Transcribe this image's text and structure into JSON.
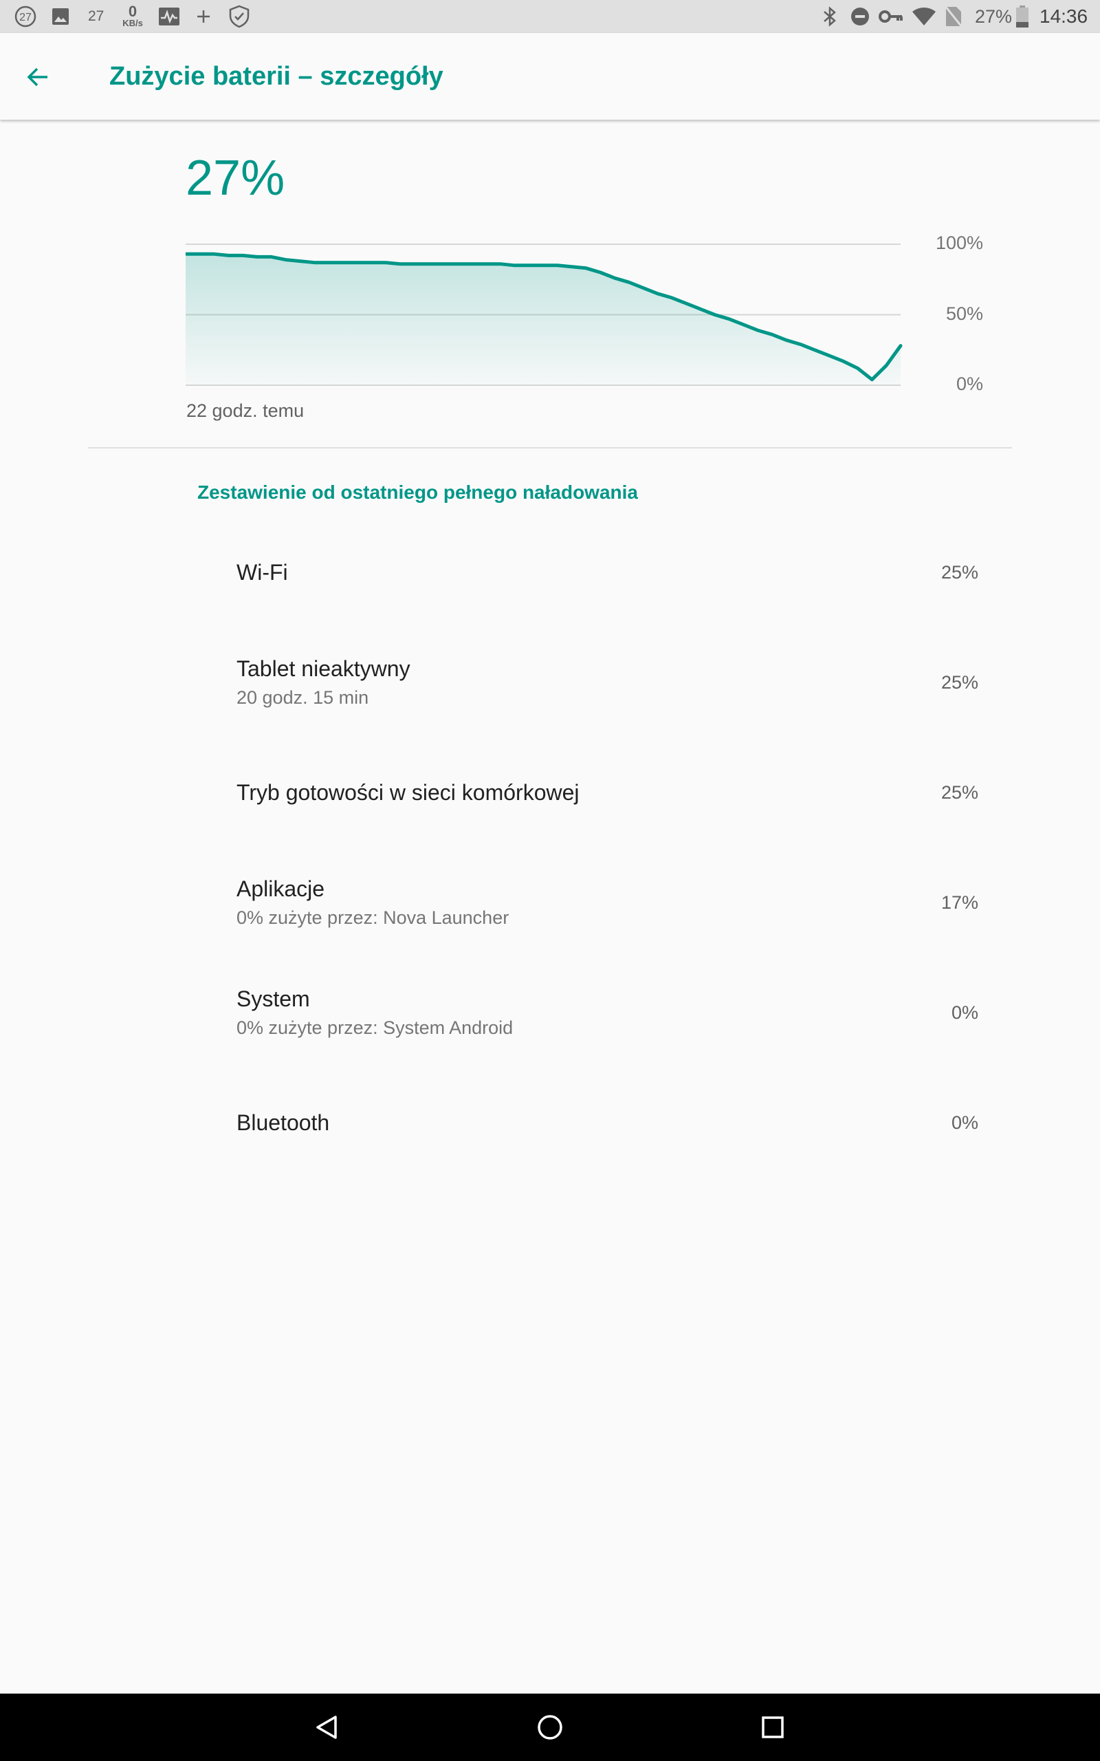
{
  "status_bar": {
    "notif_badge": "27",
    "notif_number": "27",
    "net_speed_value": "0",
    "net_speed_unit": "KB/s",
    "battery_percent": "27%",
    "time": "14:36",
    "icons": [
      "circle-27-icon",
      "image-icon",
      "activity-icon",
      "plus-icon",
      "shield-check-icon",
      "bluetooth-icon",
      "do-not-disturb-icon",
      "vpn-key-icon",
      "wifi-icon",
      "no-sim-icon",
      "battery-icon"
    ]
  },
  "app_bar": {
    "title": "Zużycie baterii – szczegóły",
    "back_icon": "arrow-back-icon"
  },
  "battery": {
    "level": "27%",
    "chart_caption": "22 godz. temu"
  },
  "chart_data": {
    "type": "area",
    "ylabel": "",
    "xlabel": "",
    "ylim": [
      0,
      100
    ],
    "y_ticks": [
      "100%",
      "50%",
      "0%"
    ],
    "x_start_label": "22 godz. temu",
    "x": [
      0,
      1,
      2,
      3,
      4,
      5,
      6,
      7,
      8,
      9,
      10,
      11,
      12,
      13,
      14,
      15,
      16,
      17,
      18,
      19,
      20,
      21,
      22,
      23,
      24,
      25,
      26,
      27,
      28,
      29,
      30,
      31,
      32,
      33,
      34,
      35,
      36,
      37,
      38,
      39,
      40,
      41,
      42,
      43,
      44,
      45,
      46,
      47,
      48,
      49,
      50
    ],
    "values": [
      93,
      93,
      93,
      92,
      92,
      91,
      91,
      89,
      88,
      87,
      87,
      87,
      87,
      87,
      87,
      86,
      86,
      86,
      86,
      86,
      86,
      86,
      86,
      85,
      85,
      85,
      85,
      84,
      83,
      80,
      76,
      73,
      69,
      65,
      62,
      58,
      54,
      50,
      47,
      43,
      39,
      36,
      32,
      29,
      25,
      21,
      17,
      12,
      4,
      14,
      28
    ],
    "series_color": "#009688",
    "grid": true
  },
  "section": {
    "header": "Zestawienie od ostatniego pełnego naładowania"
  },
  "usage_items": [
    {
      "title": "Wi-Fi",
      "summary": "",
      "value": "25%"
    },
    {
      "title": "Tablet nieaktywny",
      "summary": "20 godz. 15 min",
      "value": "25%"
    },
    {
      "title": "Tryb gotowości w sieci komórkowej",
      "summary": "",
      "value": "25%"
    },
    {
      "title": "Aplikacje",
      "summary": "0% zużyte przez: Nova Launcher",
      "value": "17%"
    },
    {
      "title": "System",
      "summary": "0% zużyte przez: System Android",
      "value": "0%"
    },
    {
      "title": "Bluetooth",
      "summary": "",
      "value": "0%"
    }
  ],
  "nav_bar": {
    "icons": [
      "back-triangle-icon",
      "home-circle-icon",
      "recents-square-icon"
    ]
  },
  "colors": {
    "accent": "#009688",
    "background": "#fafafa",
    "status_bar": "#e0e0e0",
    "nav_bar": "#000000"
  }
}
